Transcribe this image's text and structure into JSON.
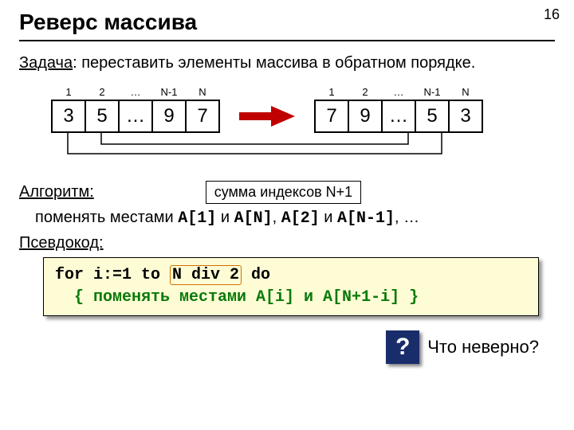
{
  "page_number": "16",
  "title": "Реверс массива",
  "task_label": "Задача",
  "task_text": ": переставить элементы массива в обратном порядке.",
  "left_array": {
    "idx": [
      "1",
      "2",
      "…",
      "N-1",
      "N"
    ],
    "vals": [
      "3",
      "5",
      "…",
      "9",
      "7"
    ]
  },
  "right_array": {
    "idx": [
      "1",
      "2",
      "…",
      "N-1",
      "N"
    ],
    "vals": [
      "7",
      "9",
      "…",
      "5",
      "3"
    ]
  },
  "algo_label": "Алгоритм:",
  "sum_note": "сумма индексов N+1",
  "algo_text_pre": "поменять местами ",
  "algo_a1": "A[1]",
  "algo_and1": " и ",
  "algo_an": "A[N]",
  "algo_sep": ", ",
  "algo_a2": "A[2]",
  "algo_and2": " и ",
  "algo_an1": "A[N-1]",
  "algo_tail": ", …",
  "pseudo_label": "Псевдокод:",
  "code": {
    "line1_pre": "for i:=1 to ",
    "highlight": "N div 2",
    "line1_post": " do",
    "line2": "  { поменять местами A[i] и A[N+1-i] }"
  },
  "question_mark": "?",
  "question_text": "Что неверно?"
}
